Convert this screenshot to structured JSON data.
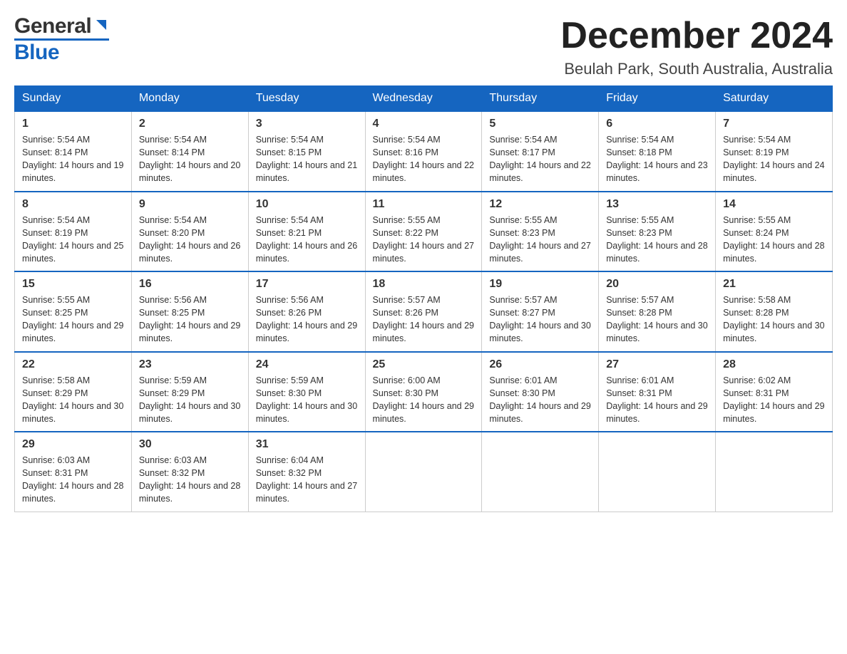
{
  "header": {
    "month_title": "December 2024",
    "location": "Beulah Park, South Australia, Australia",
    "logo_general": "General",
    "logo_blue": "Blue"
  },
  "weekdays": [
    "Sunday",
    "Monday",
    "Tuesday",
    "Wednesday",
    "Thursday",
    "Friday",
    "Saturday"
  ],
  "weeks": [
    [
      {
        "day": "1",
        "sunrise": "5:54 AM",
        "sunset": "8:14 PM",
        "daylight": "14 hours and 19 minutes."
      },
      {
        "day": "2",
        "sunrise": "5:54 AM",
        "sunset": "8:14 PM",
        "daylight": "14 hours and 20 minutes."
      },
      {
        "day": "3",
        "sunrise": "5:54 AM",
        "sunset": "8:15 PM",
        "daylight": "14 hours and 21 minutes."
      },
      {
        "day": "4",
        "sunrise": "5:54 AM",
        "sunset": "8:16 PM",
        "daylight": "14 hours and 22 minutes."
      },
      {
        "day": "5",
        "sunrise": "5:54 AM",
        "sunset": "8:17 PM",
        "daylight": "14 hours and 22 minutes."
      },
      {
        "day": "6",
        "sunrise": "5:54 AM",
        "sunset": "8:18 PM",
        "daylight": "14 hours and 23 minutes."
      },
      {
        "day": "7",
        "sunrise": "5:54 AM",
        "sunset": "8:19 PM",
        "daylight": "14 hours and 24 minutes."
      }
    ],
    [
      {
        "day": "8",
        "sunrise": "5:54 AM",
        "sunset": "8:19 PM",
        "daylight": "14 hours and 25 minutes."
      },
      {
        "day": "9",
        "sunrise": "5:54 AM",
        "sunset": "8:20 PM",
        "daylight": "14 hours and 26 minutes."
      },
      {
        "day": "10",
        "sunrise": "5:54 AM",
        "sunset": "8:21 PM",
        "daylight": "14 hours and 26 minutes."
      },
      {
        "day": "11",
        "sunrise": "5:55 AM",
        "sunset": "8:22 PM",
        "daylight": "14 hours and 27 minutes."
      },
      {
        "day": "12",
        "sunrise": "5:55 AM",
        "sunset": "8:23 PM",
        "daylight": "14 hours and 27 minutes."
      },
      {
        "day": "13",
        "sunrise": "5:55 AM",
        "sunset": "8:23 PM",
        "daylight": "14 hours and 28 minutes."
      },
      {
        "day": "14",
        "sunrise": "5:55 AM",
        "sunset": "8:24 PM",
        "daylight": "14 hours and 28 minutes."
      }
    ],
    [
      {
        "day": "15",
        "sunrise": "5:55 AM",
        "sunset": "8:25 PM",
        "daylight": "14 hours and 29 minutes."
      },
      {
        "day": "16",
        "sunrise": "5:56 AM",
        "sunset": "8:25 PM",
        "daylight": "14 hours and 29 minutes."
      },
      {
        "day": "17",
        "sunrise": "5:56 AM",
        "sunset": "8:26 PM",
        "daylight": "14 hours and 29 minutes."
      },
      {
        "day": "18",
        "sunrise": "5:57 AM",
        "sunset": "8:26 PM",
        "daylight": "14 hours and 29 minutes."
      },
      {
        "day": "19",
        "sunrise": "5:57 AM",
        "sunset": "8:27 PM",
        "daylight": "14 hours and 30 minutes."
      },
      {
        "day": "20",
        "sunrise": "5:57 AM",
        "sunset": "8:28 PM",
        "daylight": "14 hours and 30 minutes."
      },
      {
        "day": "21",
        "sunrise": "5:58 AM",
        "sunset": "8:28 PM",
        "daylight": "14 hours and 30 minutes."
      }
    ],
    [
      {
        "day": "22",
        "sunrise": "5:58 AM",
        "sunset": "8:29 PM",
        "daylight": "14 hours and 30 minutes."
      },
      {
        "day": "23",
        "sunrise": "5:59 AM",
        "sunset": "8:29 PM",
        "daylight": "14 hours and 30 minutes."
      },
      {
        "day": "24",
        "sunrise": "5:59 AM",
        "sunset": "8:30 PM",
        "daylight": "14 hours and 30 minutes."
      },
      {
        "day": "25",
        "sunrise": "6:00 AM",
        "sunset": "8:30 PM",
        "daylight": "14 hours and 29 minutes."
      },
      {
        "day": "26",
        "sunrise": "6:01 AM",
        "sunset": "8:30 PM",
        "daylight": "14 hours and 29 minutes."
      },
      {
        "day": "27",
        "sunrise": "6:01 AM",
        "sunset": "8:31 PM",
        "daylight": "14 hours and 29 minutes."
      },
      {
        "day": "28",
        "sunrise": "6:02 AM",
        "sunset": "8:31 PM",
        "daylight": "14 hours and 29 minutes."
      }
    ],
    [
      {
        "day": "29",
        "sunrise": "6:03 AM",
        "sunset": "8:31 PM",
        "daylight": "14 hours and 28 minutes."
      },
      {
        "day": "30",
        "sunrise": "6:03 AM",
        "sunset": "8:32 PM",
        "daylight": "14 hours and 28 minutes."
      },
      {
        "day": "31",
        "sunrise": "6:04 AM",
        "sunset": "8:32 PM",
        "daylight": "14 hours and 27 minutes."
      },
      null,
      null,
      null,
      null
    ]
  ]
}
